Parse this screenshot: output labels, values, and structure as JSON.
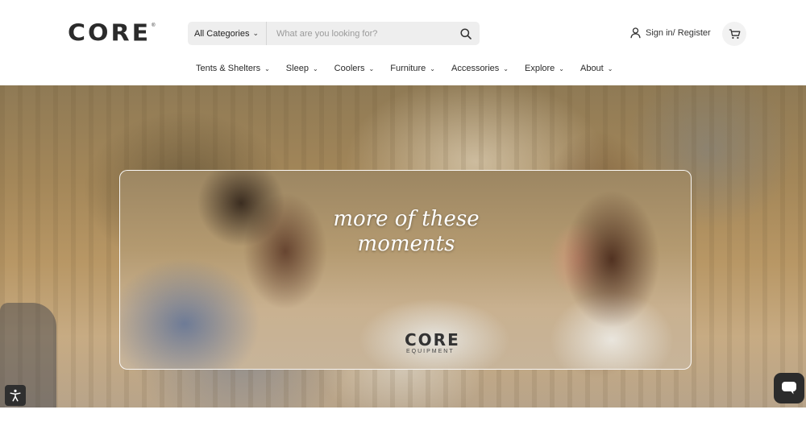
{
  "header": {
    "logo_text": "CORE",
    "logo_tm": "®",
    "search": {
      "category_label": "All Categories",
      "placeholder": "What are you looking for?",
      "value": ""
    },
    "signin_label": "Sign in/ Register",
    "icons": {
      "search": "search-icon",
      "user": "user-icon",
      "cart": "cart-icon",
      "chevron": "chevron-down-icon"
    }
  },
  "nav": {
    "items": [
      {
        "label": "Tents & Shelters"
      },
      {
        "label": "Sleep"
      },
      {
        "label": "Coolers"
      },
      {
        "label": "Furniture"
      },
      {
        "label": "Accessories"
      },
      {
        "label": "Explore"
      },
      {
        "label": "About"
      }
    ]
  },
  "hero": {
    "tagline_line1": "more of these",
    "tagline_line2": "moments",
    "product_brand": "CORE",
    "product_sub": "EQUIPMENT"
  },
  "widgets": {
    "accessibility_icon": "accessibility-icon",
    "chat_icon": "chat-icon"
  },
  "colors": {
    "text_dark": "#2b2b2b",
    "search_bg": "#eeeeee",
    "widget_bg": "#2b2b2b",
    "frame_border": "#ffffff"
  }
}
